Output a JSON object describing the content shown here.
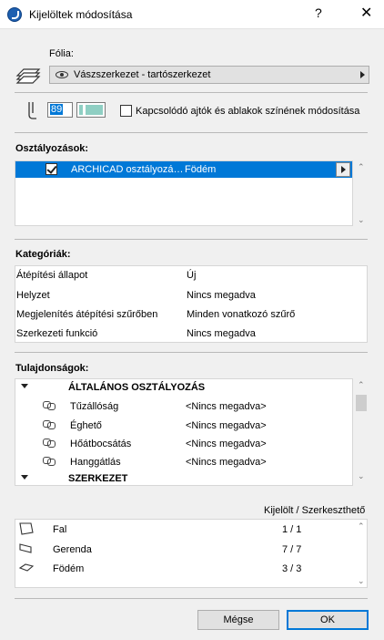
{
  "window": {
    "title": "Kijelöltek módosítása",
    "help": "?",
    "close": "✕"
  },
  "layer": {
    "label": "Fólia:",
    "value": "Vászszerkezet - tartószerkezet"
  },
  "pen": {
    "number": "89",
    "checkbox_label": "Kapcsolódó ajtók és ablakok színének módosítása",
    "checked": false
  },
  "classifications": {
    "label": "Osztályozások:",
    "rows": [
      {
        "system": "ARCHICAD osztályozá…",
        "value": "Födém",
        "checked": true
      }
    ]
  },
  "categories": {
    "label": "Kategóriák:",
    "rows": [
      {
        "name": "Átépítési állapot",
        "value": "Új"
      },
      {
        "name": "Helyzet",
        "value": "Nincs megadva"
      },
      {
        "name": "Megjelenítés átépítési szűrőben",
        "value": "Minden vonatkozó szűrő"
      },
      {
        "name": "Szerkezeti funkció",
        "value": "Nincs megadva"
      }
    ]
  },
  "properties": {
    "label": "Tulajdonságok:",
    "groups": [
      {
        "name": "ÁLTALÁNOS OSZTÁLYOZÁS",
        "rows": [
          {
            "name": "Tűzállóság",
            "value": "<Nincs megadva>"
          },
          {
            "name": "Éghető",
            "value": "<Nincs megadva>"
          },
          {
            "name": "Hőátbocsátás",
            "value": "<Nincs megadva>"
          },
          {
            "name": "Hanggátlás",
            "value": "<Nincs megadva>"
          }
        ]
      },
      {
        "name": "SZERKEZET",
        "rows": []
      }
    ]
  },
  "elements": {
    "header": "Kijelölt / Szerkeszthető",
    "rows": [
      {
        "name": "Fal",
        "count": "1  /  1",
        "icon": "wall-icon"
      },
      {
        "name": "Gerenda",
        "count": "7  /  7",
        "icon": "beam-icon"
      },
      {
        "name": "Födém",
        "count": "3  /  3",
        "icon": "slab-icon"
      }
    ]
  },
  "buttons": {
    "cancel": "Mégse",
    "ok": "OK"
  }
}
